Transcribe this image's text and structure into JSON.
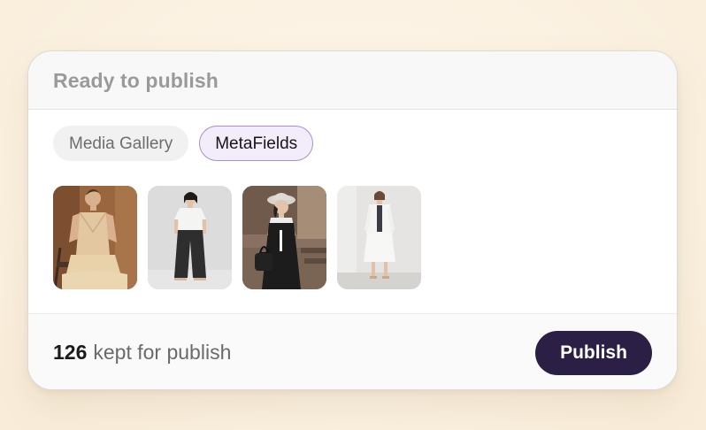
{
  "card": {
    "title": "Ready to publish"
  },
  "tabs": [
    {
      "label": "Media Gallery",
      "active": false
    },
    {
      "label": "MetaFields",
      "active": true
    }
  ],
  "gallery": {
    "images": [
      {
        "subject": "model in beige vest and skirt, seated, wood backdrop"
      },
      {
        "subject": "model in white tee and black wide pants"
      },
      {
        "subject": "model in hat, black dress, carrying bag"
      },
      {
        "subject": "model in white jacket and white skirt"
      }
    ]
  },
  "footer": {
    "kept_count": "126",
    "kept_label": "kept for publish",
    "publish_label": "Publish"
  },
  "colors": {
    "accent": "#2b1f45",
    "active_tab_bg": "#f3ecfb",
    "active_tab_border": "#a88fcb",
    "background": "#fbf1e1"
  }
}
